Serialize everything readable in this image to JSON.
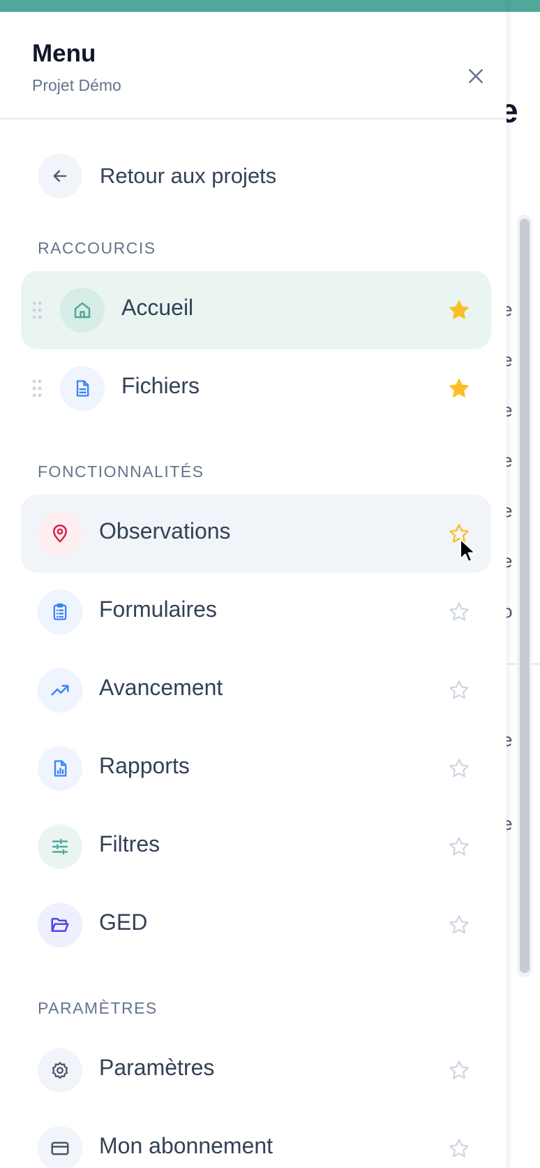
{
  "header": {
    "title": "Menu",
    "subtitle": "Projet Démo"
  },
  "back_link": {
    "label": "Retour aux projets"
  },
  "sections": {
    "shortcuts": {
      "title": "RACCOURCIS",
      "items": [
        {
          "label": "Accueil",
          "icon": "home-icon",
          "starred": true,
          "state": "active"
        },
        {
          "label": "Fichiers",
          "icon": "file-icon",
          "starred": true
        }
      ]
    },
    "features": {
      "title": "FONCTIONNALITÉS",
      "items": [
        {
          "label": "Observations",
          "icon": "map-pin-icon",
          "starred": false,
          "state": "hover"
        },
        {
          "label": "Formulaires",
          "icon": "clipboard-icon",
          "starred": false
        },
        {
          "label": "Avancement",
          "icon": "trending-up-icon",
          "starred": false
        },
        {
          "label": "Rapports",
          "icon": "report-icon",
          "starred": false
        },
        {
          "label": "Filtres",
          "icon": "sliders-icon",
          "starred": false
        },
        {
          "label": "GED",
          "icon": "folder-open-icon",
          "starred": false
        }
      ]
    },
    "settings": {
      "title": "PARAMÈTRES",
      "items": [
        {
          "label": "Paramètres",
          "icon": "gear-icon",
          "starred": false
        },
        {
          "label": "Mon abonnement",
          "icon": "credit-card-icon",
          "starred": false
        }
      ]
    }
  },
  "colors": {
    "accent": "#4fa89a",
    "star_active": "#fbbf24",
    "star_inactive": "#cbd5e1",
    "pin": "#e11d48",
    "blue_icon": "#3b82f6",
    "teal_icon": "#4fa89a",
    "indigo_icon": "#4f46e5"
  }
}
